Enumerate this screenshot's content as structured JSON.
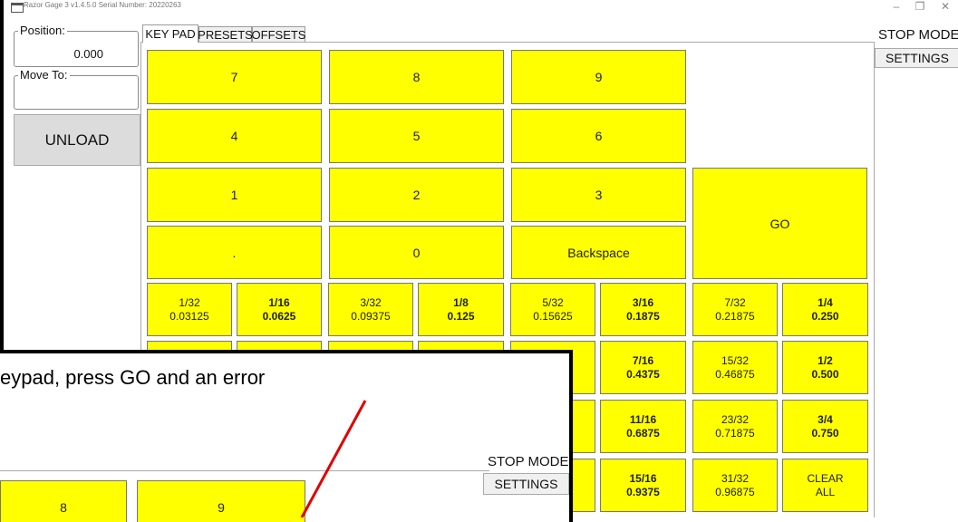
{
  "window": {
    "title": "Razor Gage 3  v1.4.5.0 Serial Number: 20220263",
    "minimize": "–",
    "maximize": "❐",
    "close": "✕"
  },
  "left_panel": {
    "position_label": "Position:",
    "position_value": "0.000",
    "move_to_label": "Move To:",
    "move_to_value": "",
    "unload_label": "UNLOAD"
  },
  "tabs": [
    {
      "label": "KEY PAD",
      "active": true
    },
    {
      "label": "PRESETS",
      "active": false
    },
    {
      "label": "OFFSETS",
      "active": false
    }
  ],
  "keypad": {
    "k7": "7",
    "k8": "8",
    "k9": "9",
    "k4": "4",
    "k5": "5",
    "k6": "6",
    "k1": "1",
    "k2": "2",
    "k3": "3",
    "kdot": ".",
    "k0": "0",
    "kback": "Backspace",
    "go": "GO"
  },
  "fractions": {
    "row1": [
      {
        "f": "1/32",
        "d": "0.03125",
        "bold": false
      },
      {
        "f": "1/16",
        "d": "0.0625",
        "bold": true
      },
      {
        "f": "3/32",
        "d": "0.09375",
        "bold": false
      },
      {
        "f": "1/8",
        "d": "0.125",
        "bold": true
      },
      {
        "f": "5/32",
        "d": "0.15625",
        "bold": false
      },
      {
        "f": "3/16",
        "d": "0.1875",
        "bold": true
      },
      {
        "f": "7/32",
        "d": "0.21875",
        "bold": false
      },
      {
        "f": "1/4",
        "d": "0.250",
        "bold": true
      }
    ],
    "row2_visible": [
      {
        "f": "7/16",
        "d": "0.4375",
        "bold": true
      },
      {
        "f": "15/32",
        "d": "0.46875",
        "bold": false
      },
      {
        "f": "1/2",
        "d": "0.500",
        "bold": true
      }
    ],
    "row3_visible": [
      {
        "f": "11/16",
        "d": "0.6875",
        "bold": true
      },
      {
        "f": "23/32",
        "d": "0.71875",
        "bold": false
      },
      {
        "f": "3/4",
        "d": "0.750",
        "bold": true
      }
    ],
    "row4_visible": [
      {
        "f": "15/16",
        "d": "0.9375",
        "bold": true
      },
      {
        "f": "31/32",
        "d": "0.96875",
        "bold": false
      },
      {
        "f": "CLEAR",
        "d": "ALL",
        "bold": false
      }
    ]
  },
  "right_panel": {
    "stop_mode": "STOP MODE",
    "settings": "SETTINGS"
  },
  "overlay": {
    "annotation_text": "eypad, press GO and an error",
    "stop_mode": "STOP MODE",
    "settings": "SETTINGS",
    "k8": "8",
    "k9": "9"
  },
  "colors": {
    "button_yellow": "#ffff00",
    "arrow_red": "#e00000"
  }
}
